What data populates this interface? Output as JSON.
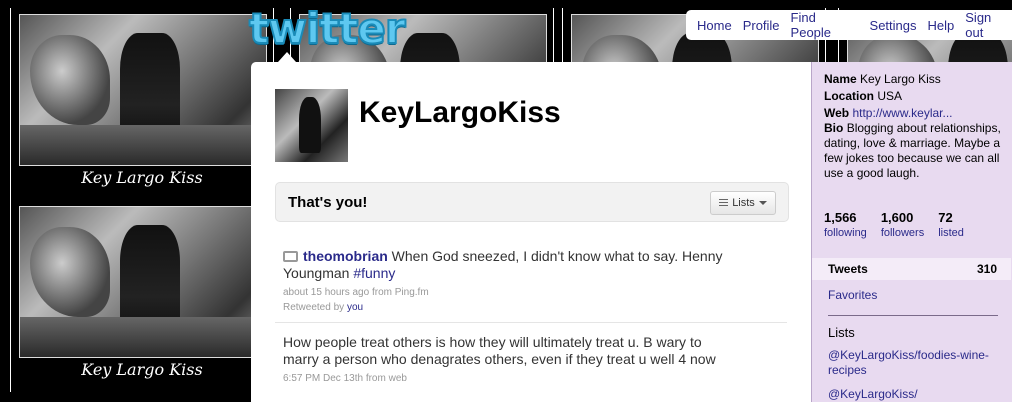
{
  "background": {
    "tile_caption": "Key Largo Kiss"
  },
  "logo": "twitter",
  "nav": [
    "Home",
    "Profile",
    "Find People",
    "Settings",
    "Help",
    "Sign out"
  ],
  "profile": {
    "username": "KeyLargoKiss"
  },
  "banner": {
    "label": "That's you!",
    "lists_button": "Lists"
  },
  "timeline": [
    {
      "author": "theomobrian",
      "text": "When God sneezed, I didn't know what to say. Henny Youngman",
      "hashtag": "#funny",
      "time": "about 15 hours ago",
      "source": "from Ping.fm",
      "retweeted_by_prefix": "Retweeted by",
      "retweeted_by": "you"
    },
    {
      "text": "How people treat others is how they will ultimately treat u. B wary to marry a person who denagrates others, even if they treat u well 4 now",
      "time": "6:57 PM Dec 13th",
      "source": "from web"
    }
  ],
  "sidebar": {
    "name_label": "Name",
    "name": "Key Largo Kiss",
    "location_label": "Location",
    "location": "USA",
    "web_label": "Web",
    "web": "http://www.keylar...",
    "bio_label": "Bio",
    "bio": "Blogging about relationships, dating, love & marriage. Maybe a few jokes too because we can all use a good laugh.",
    "stats": [
      {
        "count": "1,566",
        "label": "following"
      },
      {
        "count": "1,600",
        "label": "followers"
      },
      {
        "count": "72",
        "label": "listed"
      }
    ],
    "tweets_label": "Tweets",
    "tweets_count": "310",
    "favorites": "Favorites",
    "lists_heading": "Lists",
    "lists": [
      "@KeyLargoKiss/foodies-wine-recipes",
      "@KeyLargoKiss/"
    ]
  },
  "colors": {
    "sidebar_bg": "#e8daf0",
    "link": "#2a2a8a",
    "logo": "#5ec8f0"
  }
}
